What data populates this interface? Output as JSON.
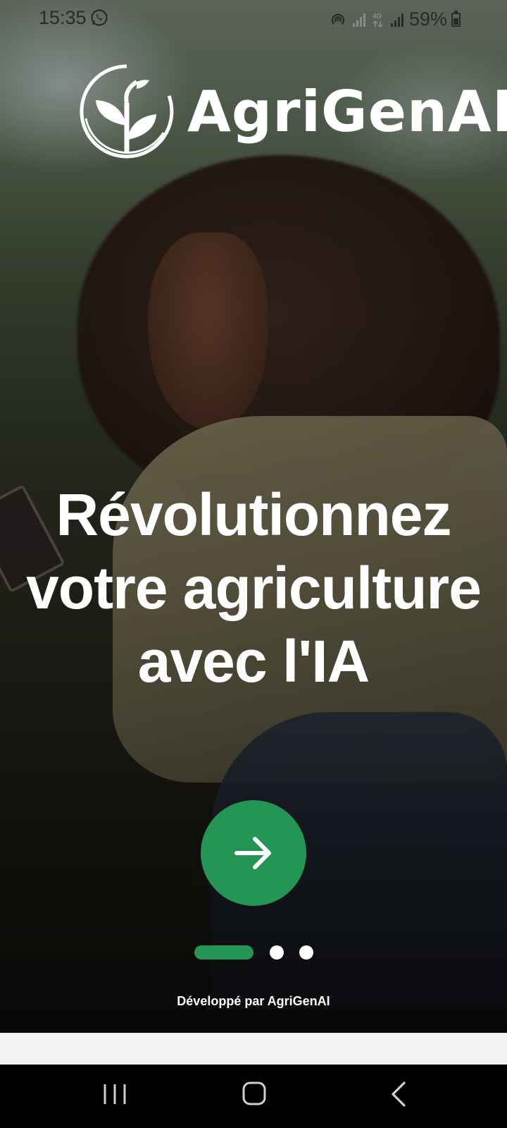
{
  "status_bar": {
    "time": "15:35",
    "battery": "59%",
    "network": "4G",
    "icons": [
      "whatsapp-icon",
      "hotspot-icon",
      "signal-icon",
      "4g-icon",
      "signal-icon",
      "battery-icon"
    ]
  },
  "app": {
    "brand_name": "AgriGenAI",
    "accent_color": "#239656"
  },
  "hero": {
    "headline_lines": [
      "Révolutionnez",
      "votre agriculture",
      "avec l'IA"
    ]
  },
  "onboarding": {
    "next_button_icon": "arrow-right-icon",
    "page_count": 3,
    "current_page": 1
  },
  "footer": {
    "credit": "Développé par AgriGenAI"
  },
  "nav_bar": {
    "items": [
      "recents-icon",
      "home-icon",
      "back-icon"
    ]
  }
}
